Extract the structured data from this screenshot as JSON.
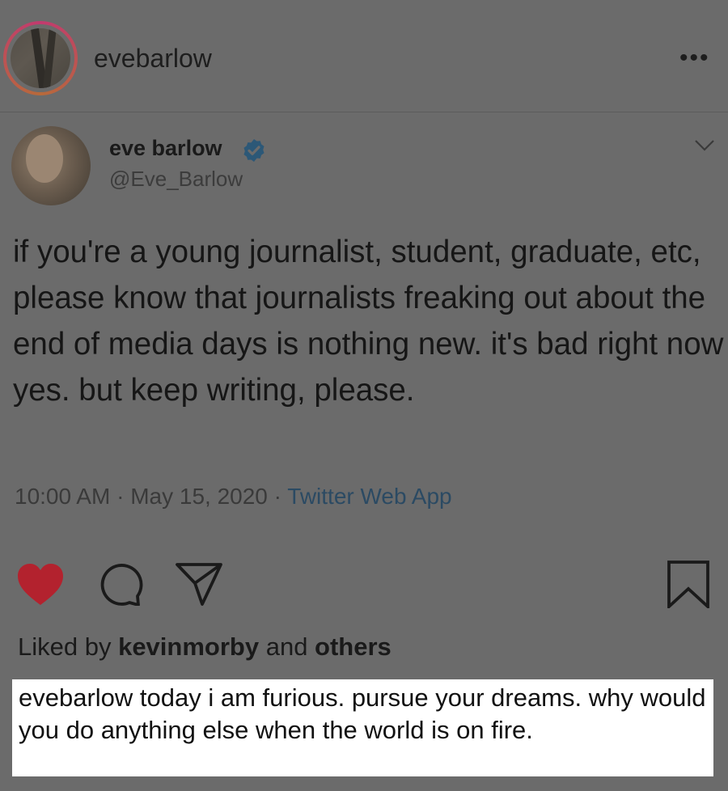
{
  "post_header": {
    "username": "evebarlow",
    "more_label": "•••"
  },
  "tweet": {
    "display_name": "eve barlow",
    "handle": "@Eve_Barlow",
    "text": "if you're a young journalist, student, graduate, etc, please know that journalists freaking out about the end of media days is nothing new. it's bad right now yes. but keep writing, please.",
    "time": "10:00 AM",
    "separator": " · ",
    "date": "May 15, 2020",
    "source": "Twitter Web App"
  },
  "actions": {
    "like_icon": "heart-icon",
    "comment_icon": "comment-icon",
    "share_icon": "send-icon",
    "save_icon": "bookmark-icon",
    "like_color": "#b3222e"
  },
  "likes": {
    "prefix": "Liked by ",
    "user": "kevinmorby",
    "middle": " and ",
    "others": "others"
  },
  "caption": {
    "username": "evebarlow",
    "text": " today i am furious. pursue your dreams. why would you do anything else when the world is on fire."
  }
}
